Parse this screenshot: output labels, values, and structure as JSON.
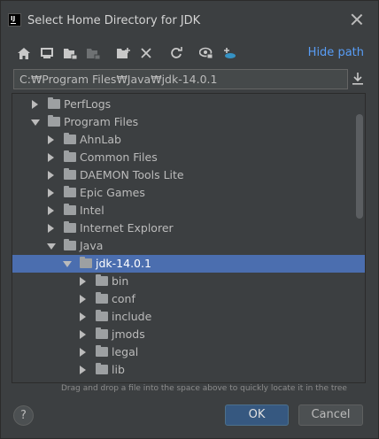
{
  "window": {
    "title": "Select Home Directory for JDK",
    "logo_text": "IJ"
  },
  "toolbar": {
    "buttons": [
      {
        "icon": "home-icon"
      },
      {
        "icon": "desktop-icon"
      },
      {
        "icon": "project-folder-icon"
      },
      {
        "icon": "module-folder-icon"
      },
      {
        "icon": "new-folder-icon"
      },
      {
        "icon": "delete-icon"
      },
      {
        "icon": "refresh-icon"
      },
      {
        "icon": "show-hidden-icon"
      },
      {
        "icon": "cloud-icon"
      }
    ],
    "hide_path_label": "Hide path"
  },
  "path": {
    "value": "C:₩Program Files₩Java₩jdk-14.0.1"
  },
  "tree": {
    "items": [
      {
        "label": "PerfLogs",
        "expanded": false
      },
      {
        "label": "Program Files",
        "expanded": true
      },
      {
        "label": "AhnLab",
        "expanded": false
      },
      {
        "label": "Common Files",
        "expanded": false
      },
      {
        "label": "DAEMON Tools Lite",
        "expanded": false
      },
      {
        "label": "Epic Games",
        "expanded": false
      },
      {
        "label": "Intel",
        "expanded": false
      },
      {
        "label": "Internet Explorer",
        "expanded": false
      },
      {
        "label": "Java",
        "expanded": true
      },
      {
        "label": "jdk-14.0.1",
        "expanded": true,
        "selected": true
      },
      {
        "label": "bin",
        "expanded": false
      },
      {
        "label": "conf",
        "expanded": false
      },
      {
        "label": "include",
        "expanded": false
      },
      {
        "label": "jmods",
        "expanded": false
      },
      {
        "label": "legal",
        "expanded": false
      },
      {
        "label": "lib",
        "expanded": false
      }
    ]
  },
  "hint": "Drag and drop a file into the space above to quickly locate it in the tree",
  "footer": {
    "help_label": "?",
    "ok_label": "OK",
    "cancel_label": "Cancel"
  },
  "colors": {
    "background": "#3c3f41",
    "selection": "#4b6eaf",
    "link": "#589df6",
    "ok_button": "#365880"
  }
}
